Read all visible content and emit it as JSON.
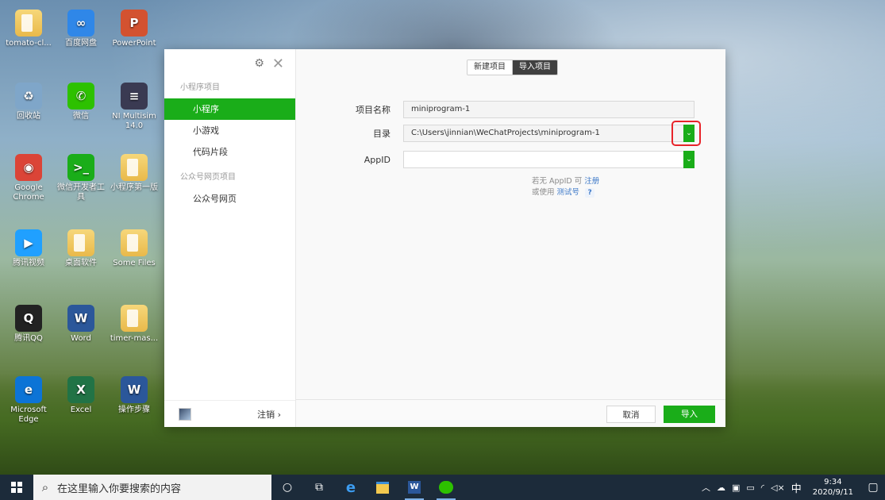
{
  "desktop": {
    "icons": [
      {
        "label": "tomato-cl...",
        "kind": "folder"
      },
      {
        "label": "百度网盘",
        "kind": "app",
        "color": "#2f87e8",
        "glyph": "∞"
      },
      {
        "label": "PowerPoint",
        "kind": "app",
        "color": "#d35230",
        "glyph": "P"
      },
      {
        "label": "回收站",
        "kind": "app",
        "color": "#7fa6c9",
        "glyph": "♻"
      },
      {
        "label": "微信",
        "kind": "app",
        "color": "#2dc100",
        "glyph": "✆"
      },
      {
        "label": "NI Multisim 14.0",
        "kind": "app",
        "color": "#3a3a52",
        "glyph": "≡"
      },
      {
        "label": "Google Chrome",
        "kind": "app",
        "color": "#db4437",
        "glyph": "◉"
      },
      {
        "label": "微信开发者工具",
        "kind": "app",
        "color": "#1aad19",
        "glyph": ">_"
      },
      {
        "label": "小程序第一版",
        "kind": "folder"
      },
      {
        "label": "腾讯视频",
        "kind": "app",
        "color": "#20a0ff",
        "glyph": "▶"
      },
      {
        "label": "桌面软件",
        "kind": "folder"
      },
      {
        "label": "Some Files",
        "kind": "folder"
      },
      {
        "label": "腾讯QQ",
        "kind": "app",
        "color": "#222222",
        "glyph": "Q"
      },
      {
        "label": "Word",
        "kind": "app",
        "color": "#2b579a",
        "glyph": "W"
      },
      {
        "label": "timer-mas...",
        "kind": "folder"
      },
      {
        "label": "Microsoft Edge",
        "kind": "app",
        "color": "#0c74d6",
        "glyph": "e"
      },
      {
        "label": "Excel",
        "kind": "app",
        "color": "#217346",
        "glyph": "X"
      },
      {
        "label": "操作步骤",
        "kind": "app",
        "color": "#2b579a",
        "glyph": "W"
      }
    ]
  },
  "dialog": {
    "settings_icon": "gear-icon",
    "close_icon": "close-icon",
    "sidebar": {
      "groups": [
        {
          "title": "小程序项目",
          "items": [
            {
              "label": "小程序",
              "active": true
            },
            {
              "label": "小游戏",
              "active": false
            },
            {
              "label": "代码片段",
              "active": false
            }
          ]
        },
        {
          "title": "公众号网页项目",
          "items": [
            {
              "label": "公众号网页",
              "active": false
            }
          ]
        }
      ],
      "logout_label": "注销 ›"
    },
    "tabs": {
      "new_label": "新建项目",
      "import_label": "导入项目"
    },
    "form": {
      "name_label": "项目名称",
      "name_value": "miniprogram-1",
      "dir_label": "目录",
      "dir_value": "C:\\Users\\jinnian\\WeChatProjects\\miniprogram-1",
      "appid_label": "AppID",
      "appid_value": "",
      "hint_line1_prefix": "若无 AppID 可",
      "hint_register": "注册",
      "hint_line2_prefix": "或使用",
      "hint_test": "测试号",
      "hint_q": "?"
    },
    "buttons": {
      "cancel": "取消",
      "import": "导入"
    }
  },
  "taskbar": {
    "search_placeholder": "在这里输入你要搜索的内容",
    "tray_ime": "中",
    "time": "9:34",
    "date": "2020/9/11"
  },
  "colors": {
    "accent": "#1aad19",
    "highlight": "#e8242a",
    "taskbar": "#1c2b3a"
  }
}
